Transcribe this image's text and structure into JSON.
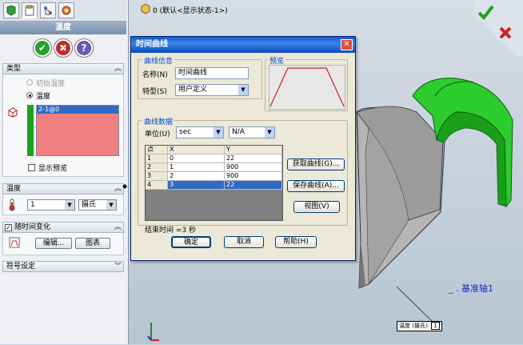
{
  "viewport": {
    "tree_label": "0  (默认<显示状态-1>)",
    "axis_label": "基准轴1",
    "callout_label": "温度 (摄氏)",
    "callout_value": "1"
  },
  "panel": {
    "title": "温度",
    "tabs": [
      "property-manager-icon",
      "feature-manager-icon",
      "config-manager-icon",
      "display-manager-icon"
    ],
    "ok_label": "✔",
    "cancel_label": "✖",
    "help_label": "?",
    "type_section": {
      "header": "类型",
      "opt_initial": "初始温度",
      "opt_temp": "温度",
      "selection_item": "2-1@0",
      "show_preview": "显示预览"
    },
    "temp_section": {
      "header": "温度",
      "value": "1",
      "unit": "摄氏"
    },
    "time_section": {
      "header": "随时间变化",
      "edit_label": "编辑...",
      "chart_label": "图表"
    },
    "symbol_section": {
      "header": "符号设定"
    }
  },
  "dialog": {
    "title": "时间曲线",
    "close_label": "✕",
    "info_group": "曲线信息",
    "name_label": "名称(N)",
    "name_value": "时间曲线",
    "type_label": "特型(S)",
    "type_value": "用户定义",
    "preview_group": "预览",
    "data_group": "曲线数据",
    "unit_label": "单位(U)",
    "unit_value": "sec",
    "unit_value2": "N/A",
    "table": {
      "headers": [
        "点",
        "X",
        "Y"
      ],
      "rows": [
        [
          "1",
          "0",
          "22"
        ],
        [
          "2",
          "1",
          "900"
        ],
        [
          "3",
          "2",
          "900"
        ],
        [
          "4",
          "3",
          "22"
        ]
      ]
    },
    "get_curve": "获取曲线(G)...",
    "save_curve": "保存曲线(A)...",
    "view_label": "视图(V)",
    "end_time": "结束时间 =3 秒",
    "ok": "确定",
    "cancel": "取消",
    "help": "帮助(H)"
  }
}
